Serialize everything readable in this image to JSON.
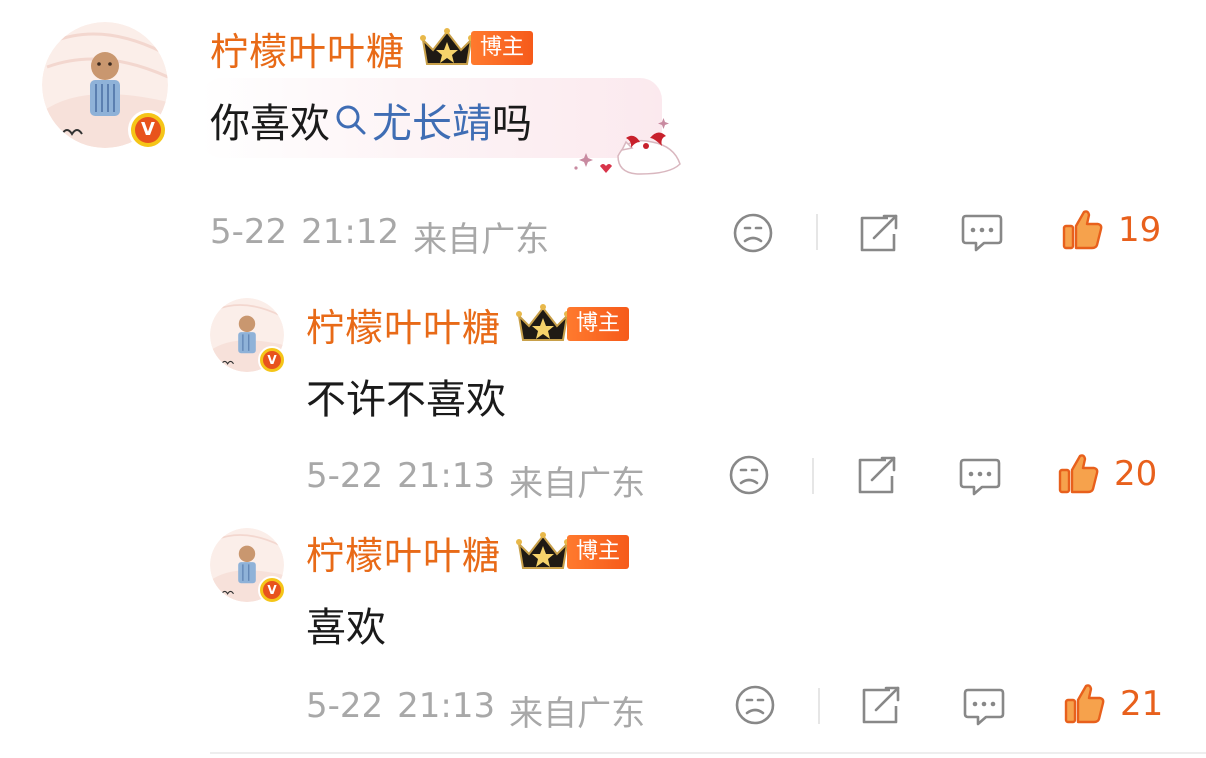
{
  "comments": [
    {
      "username": "柠檬叶叶糖",
      "tag": "博主",
      "text_prefix": "你喜欢",
      "topic": "尤长靖",
      "text_suffix": "吗",
      "date": "5-22",
      "time": "21:12",
      "location": "来自广东",
      "likes": "19"
    },
    {
      "username": "柠檬叶叶糖",
      "tag": "博主",
      "text": "不许不喜欢",
      "date": "5-22",
      "time": "21:13",
      "location": "来自广东",
      "likes": "20"
    },
    {
      "username": "柠檬叶叶糖",
      "tag": "博主",
      "text": "喜欢",
      "date": "5-22",
      "time": "21:13",
      "location": "来自广东",
      "likes": "21"
    }
  ],
  "verify_mark": "V",
  "colors": {
    "username": "#e86a17",
    "topic_link": "#3f6db4",
    "meta": "#a8a8a8",
    "like_active": "#e8601c",
    "tag_bg": "#f65a1a"
  },
  "icons": [
    "sad-face-icon",
    "share-icon",
    "comment-icon",
    "thumbs-up-icon",
    "search-icon",
    "crown-icon",
    "verified-badge-icon"
  ]
}
